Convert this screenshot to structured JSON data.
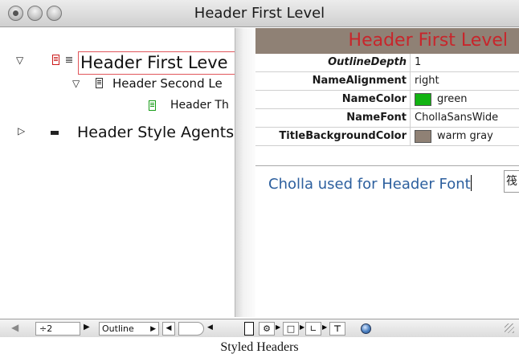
{
  "window": {
    "title": "Header First Level"
  },
  "outline": {
    "topics": [
      {
        "label": "Header First Leve",
        "level": 1,
        "expanded": true,
        "icon": "red-document-icon"
      },
      {
        "label": "Header Second Le",
        "level": 2,
        "expanded": true,
        "icon": "document-icon"
      },
      {
        "label": "Header Th",
        "level": 3,
        "icon": "green-document-icon"
      },
      {
        "label": "Header Style Agents",
        "level": 1,
        "expanded": false,
        "icon": "dash-icon"
      }
    ]
  },
  "inspector": {
    "header_title": "Header First Level",
    "properties": [
      {
        "name": "OutlineDepth",
        "value": "1"
      },
      {
        "name": "NameAlignment",
        "value": "right"
      },
      {
        "name": "NameColor",
        "value": "green",
        "swatch": "#12b312"
      },
      {
        "name": "NameFont",
        "value": "ChollaSansWide"
      },
      {
        "name": "TitleBackgroundColor",
        "value": "warm gray",
        "swatch": "#8f8175"
      }
    ],
    "note_text": "Cholla used for Header Font",
    "note_button_glyph": "筏"
  },
  "toolbar": {
    "zoom_value": "÷2",
    "view_mode": "Outline"
  },
  "caption": "Styled Headers",
  "colors": {
    "header_band": "#8f8175",
    "header_text": "#c8252b",
    "note_text": "#2c5f9e"
  }
}
